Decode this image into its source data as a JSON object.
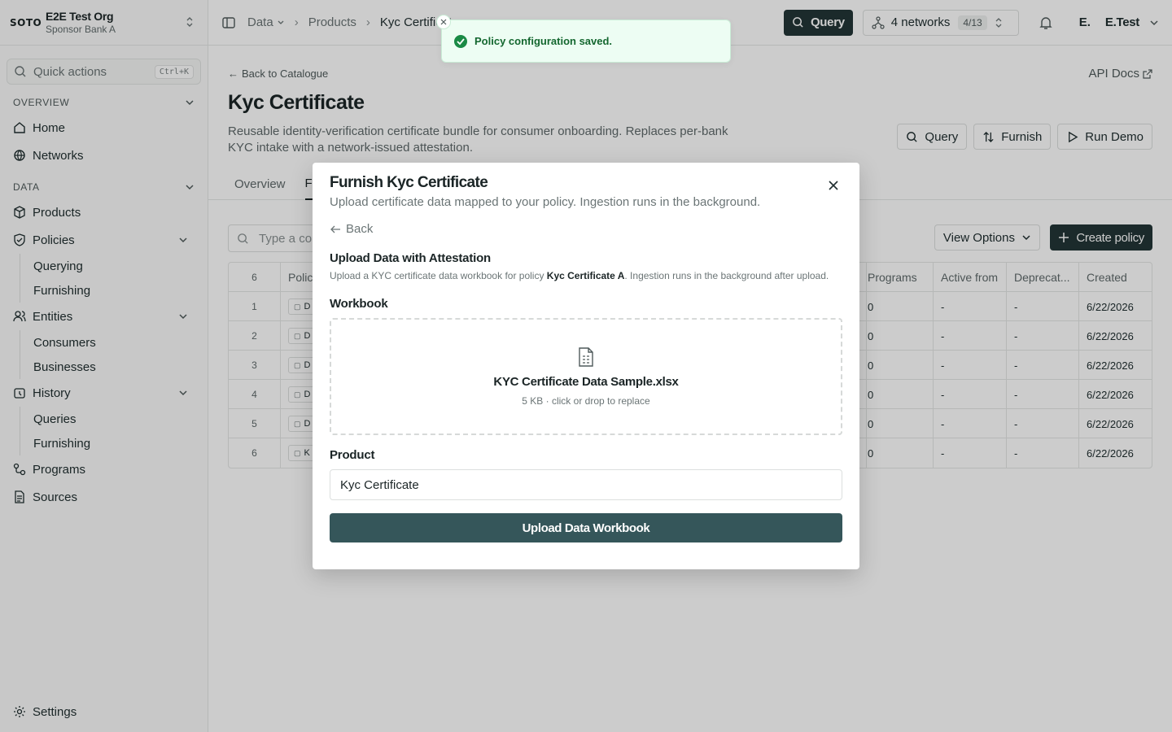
{
  "org": {
    "logo": "SOTO",
    "name": "E2E Test Org",
    "subtitle": "Sponsor Bank A"
  },
  "quick_actions": {
    "label": "Quick actions",
    "shortcut": "Ctrl+K"
  },
  "sidebar": {
    "overview_label": "OVERVIEW",
    "home": "Home",
    "networks": "Networks",
    "data_label": "DATA",
    "products": "Products",
    "policies": "Policies",
    "querying": "Querying",
    "furnishing": "Furnishing",
    "entities": "Entities",
    "consumers": "Consumers",
    "businesses": "Businesses",
    "history": "History",
    "queries": "Queries",
    "history_furnishing": "Furnishing",
    "programs": "Programs",
    "sources": "Sources",
    "settings": "Settings"
  },
  "breadcrumb": {
    "data": "Data",
    "products": "Products",
    "current": "Kyc Certificate"
  },
  "topbar": {
    "query": "Query",
    "networks": "4 networks",
    "networks_badge": "4/13",
    "user_initial": "E.",
    "user_name": "E.Test"
  },
  "page": {
    "back": "Back to Catalogue",
    "api_docs": "API Docs",
    "title": "Kyc Certificate",
    "description": "Reusable identity-verification certificate bundle for consumer onboarding. Replaces per-bank KYC intake with a network-issued attestation.",
    "actions": {
      "query": "Query",
      "furnish": "Furnish",
      "run_demo": "Run Demo"
    },
    "tabs": [
      "Overview",
      "Fu"
    ],
    "filter_placeholder": "Type a co",
    "view_options": "View Options",
    "create_policy": "Create policy"
  },
  "table": {
    "count": "6",
    "headers": {
      "policy": "Polic",
      "programs": "Programs",
      "active_from": "Active from",
      "deprecated": "Deprecat...",
      "created": "Created"
    },
    "rows": [
      {
        "n": "1",
        "pill": "D",
        "programs": "0",
        "active_from": "-",
        "deprecated": "-",
        "created": "6/22/2026"
      },
      {
        "n": "2",
        "pill": "D",
        "programs": "0",
        "active_from": "-",
        "deprecated": "-",
        "created": "6/22/2026"
      },
      {
        "n": "3",
        "pill": "D",
        "programs": "0",
        "active_from": "-",
        "deprecated": "-",
        "created": "6/22/2026"
      },
      {
        "n": "4",
        "pill": "D",
        "programs": "0",
        "active_from": "-",
        "deprecated": "-",
        "created": "6/22/2026"
      },
      {
        "n": "5",
        "pill": "D",
        "programs": "0",
        "active_from": "-",
        "deprecated": "-",
        "created": "6/22/2026"
      },
      {
        "n": "6",
        "pill": "K",
        "programs": "0",
        "active_from": "-",
        "deprecated": "-",
        "created": "6/22/2026"
      }
    ]
  },
  "modal": {
    "title": "Furnish Kyc Certificate",
    "subtitle": "Upload certificate data mapped to your policy. Ingestion runs in the background.",
    "back": "Back",
    "section_title": "Upload Data with Attestation",
    "note_before": "Upload a KYC certificate data workbook for policy ",
    "note_policy": "Kyc Certificate A",
    "note_after": ". Ingestion runs in the background after upload.",
    "workbook_label": "Workbook",
    "file_name": "KYC Certificate Data Sample.xlsx",
    "file_meta": "5 KB · click or drop to replace",
    "product_label": "Product",
    "product_value": "Kyc Certificate",
    "upload_button": "Upload Data Workbook"
  },
  "toast": {
    "message": "Policy configuration saved."
  },
  "colors": {
    "accent": "#223536",
    "upload_button": "#35565a",
    "toast_bg": "#edfdf3",
    "toast_text": "#14672f"
  }
}
